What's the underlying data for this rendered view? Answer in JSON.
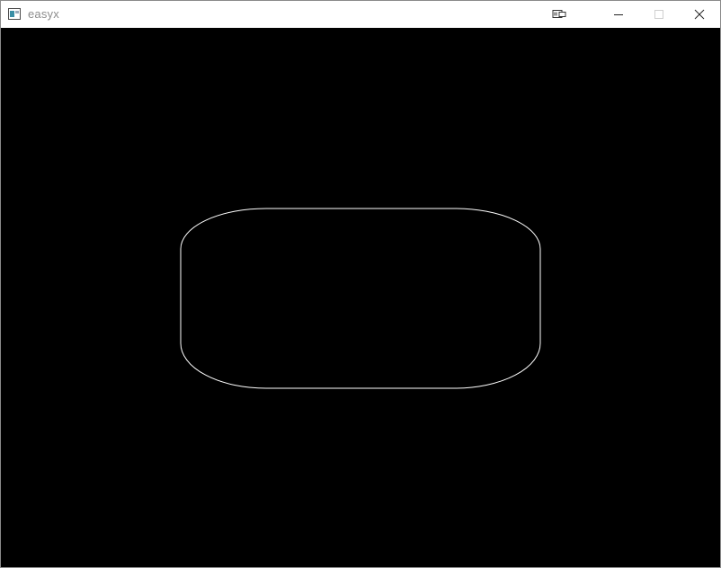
{
  "window": {
    "title": "easyx",
    "controls": {
      "extra": "window-tool-icon",
      "minimize": "minimize-icon",
      "maximize": "maximize-icon",
      "close": "close-icon"
    }
  },
  "canvas": {
    "background": "#000000",
    "shape": {
      "type": "rounded-rectangle",
      "stroke": "#ffffff",
      "fill": "none"
    }
  }
}
